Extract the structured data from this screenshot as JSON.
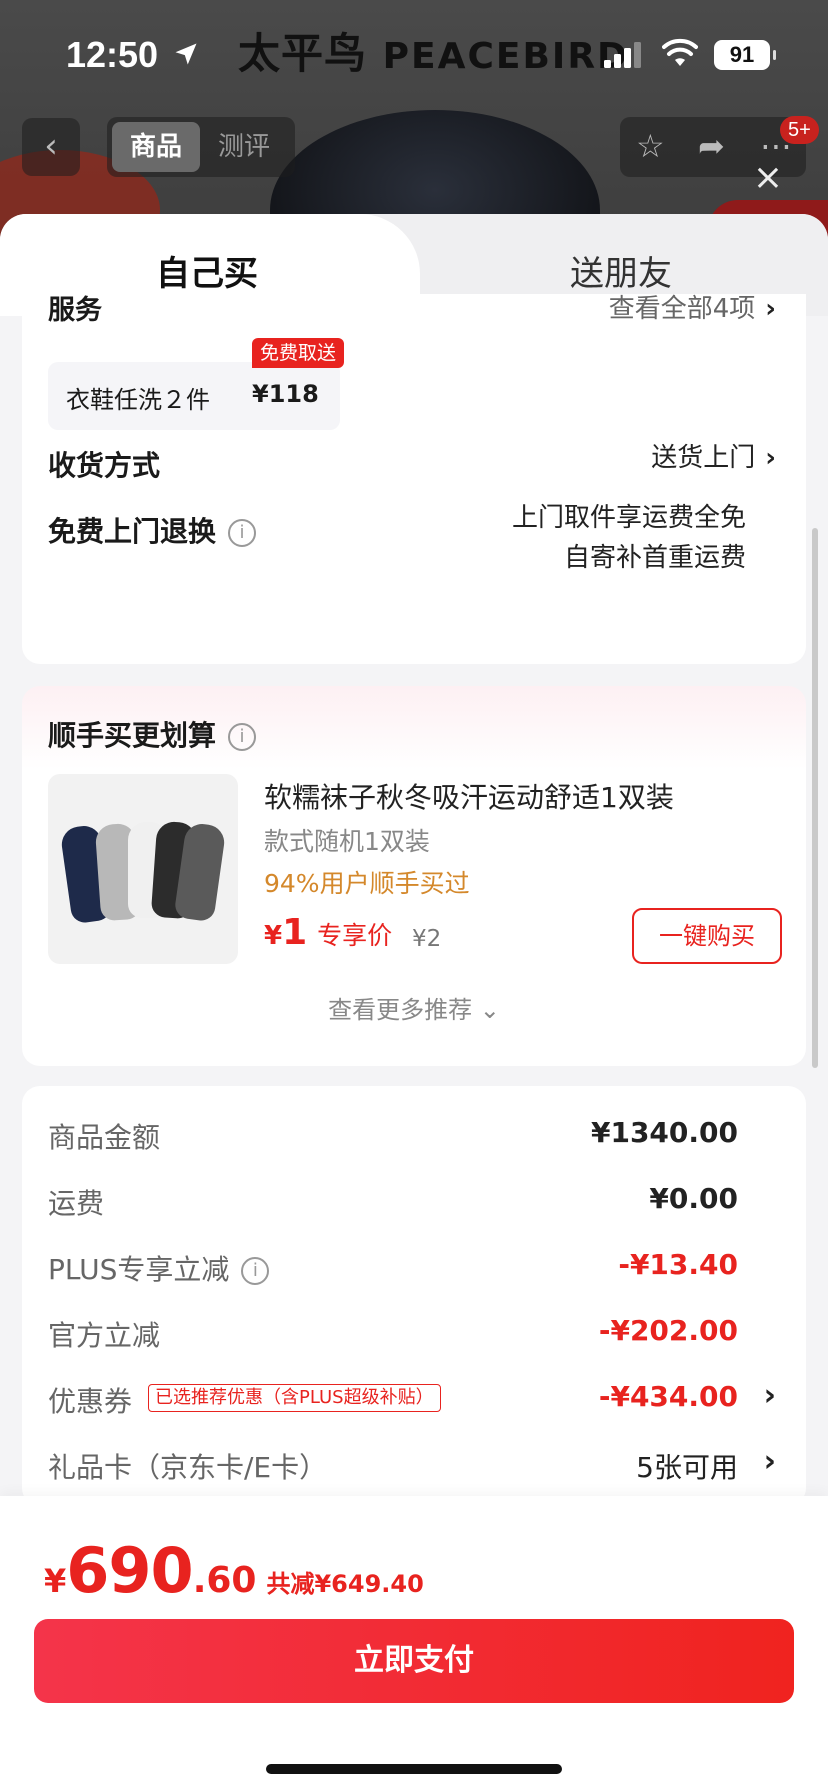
{
  "status_bar": {
    "time": "12:50",
    "battery": "91"
  },
  "brand": {
    "cn": "太平鸟",
    "en": "PEACEBIRD"
  },
  "background_nav": {
    "back_glyph": "‹",
    "segments": [
      "商品",
      "测评"
    ],
    "active_segment": 0,
    "badge": "5+",
    "close_glyph": "×"
  },
  "tabs": {
    "self_buy": "自己买",
    "gift": "送朋友"
  },
  "service": {
    "title": "服务",
    "more": "查看全部4项",
    "chip_name": "衣鞋任洗２件",
    "chip_price": "¥118",
    "chip_tag": "免费取送"
  },
  "delivery": {
    "label": "收货方式",
    "value": "送货上门"
  },
  "free_return": {
    "label": "免费上门退换",
    "line1": "上门取件享运费全免",
    "line2": "自寄补首重运费"
  },
  "upsell": {
    "title": "顺手买更划算",
    "product_name": "软糯袜子秋冬吸汗运动舒适1双装",
    "variant": "款式随机1双装",
    "stat": "94%用户顺手买过",
    "currency": "¥",
    "price": "1",
    "price_label": "专享价",
    "original_price": "¥2",
    "buy_button": "一键购买",
    "more": "查看更多推荐"
  },
  "price_summary": {
    "rows": [
      {
        "label": "商品金额",
        "value": "¥1340.00"
      },
      {
        "label": "运费",
        "value": "¥0.00"
      },
      {
        "label": "PLUS专享立减",
        "value": "-¥13.40"
      },
      {
        "label": "官方立减",
        "value": "-¥202.00"
      },
      {
        "label": "优惠券",
        "tag": "已选推荐优惠（含PLUS超级补贴）",
        "value": "-¥434.00"
      },
      {
        "label": "礼品卡（京东卡/E卡）",
        "value": "5张可用"
      }
    ]
  },
  "footer": {
    "currency": "¥",
    "total_int": "690",
    "total_dec": ".60",
    "savings": "共减¥649.40",
    "pay_button": "立即支付"
  },
  "colors": {
    "accent": "#e8231f",
    "orange": "#d4882b",
    "sheet_bg": "#f4f4f6"
  }
}
